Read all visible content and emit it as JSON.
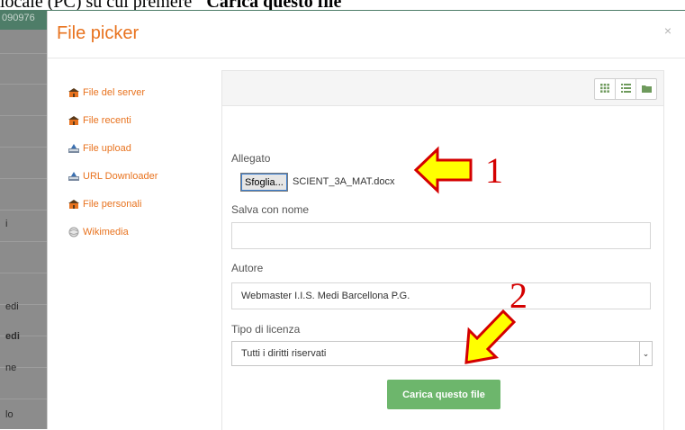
{
  "caption": {
    "before": "locale (PC) su cui premere ",
    "bold": "\"Carica questo file\""
  },
  "background": {
    "top_number": "090976",
    "sidebar_labels": [
      "i",
      "edi",
      "edi",
      "ne",
      "lo"
    ]
  },
  "modal": {
    "title": "File picker",
    "close": "×"
  },
  "repositories": [
    {
      "label": "File del server",
      "icon": "server-files-icon"
    },
    {
      "label": "File recenti",
      "icon": "recent-files-icon"
    },
    {
      "label": "File upload",
      "icon": "upload-icon"
    },
    {
      "label": "URL Downloader",
      "icon": "url-download-icon"
    },
    {
      "label": "File personali",
      "icon": "private-files-icon"
    },
    {
      "label": "Wikimedia",
      "icon": "wikimedia-icon"
    }
  ],
  "form": {
    "attachment_label": "Allegato",
    "browse_button": "Sfoglia...",
    "selected_file": "SCIENT_3A_MAT.docx",
    "save_as_label": "Salva con nome",
    "save_as_value": "",
    "author_label": "Autore",
    "author_value": "Webmaster I.I.S. Medi Barcellona P.G.",
    "license_label": "Tipo di licenza",
    "license_value": "Tutti i diritti riservati",
    "submit_button": "Carica questo file"
  },
  "annotations": {
    "step1": "1",
    "step2": "2",
    "arrow_color": "#ffff00",
    "arrow_outline": "#d40000"
  },
  "colors": {
    "accent": "#e8731f",
    "submit": "#6db66c",
    "overlay": "#8a8a8a"
  }
}
